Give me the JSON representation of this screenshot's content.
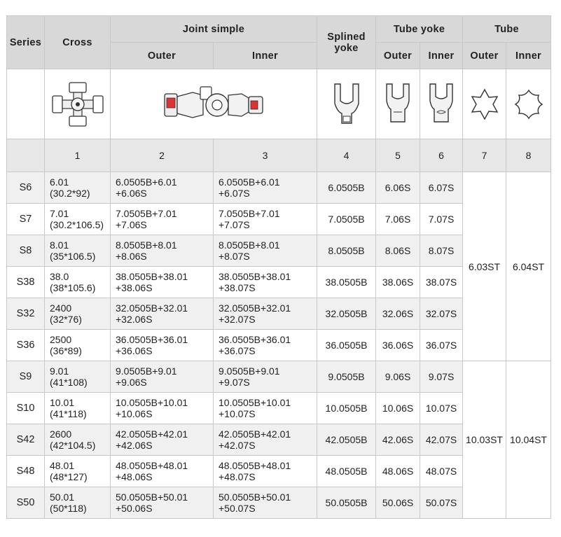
{
  "headers": {
    "series": "Series",
    "cross": "Cross",
    "joint_simple": "Joint simple",
    "outer": "Outer",
    "inner": "Inner",
    "splined_yoke": [
      "Splined",
      "yoke"
    ],
    "tube_yoke": "Tube yoke",
    "tube_yoke_outer": "Outer",
    "tube_yoke_inner": "Inner",
    "tube": "Tube",
    "tube_outer": "Outer",
    "tube_inner": "Inner"
  },
  "index_row": [
    "1",
    "2",
    "3",
    "4",
    "5",
    "6",
    "7",
    "8"
  ],
  "rows": [
    {
      "series": "S6",
      "cross": [
        "6.01",
        "(30.2*92)"
      ],
      "outer": [
        "6.0505B+6.01",
        "+6.06S"
      ],
      "inner": [
        "6.0505B+6.01",
        "+6.07S"
      ],
      "splined": "6.0505B",
      "ty_outer": "6.06S",
      "ty_inner": "6.07S"
    },
    {
      "series": "S7",
      "cross": [
        "7.01",
        "(30.2*106.5)"
      ],
      "outer": [
        "7.0505B+7.01",
        "+7.06S"
      ],
      "inner": [
        "7.0505B+7.01",
        "+7.07S"
      ],
      "splined": "7.0505B",
      "ty_outer": "7.06S",
      "ty_inner": "7.07S"
    },
    {
      "series": "S8",
      "cross": [
        "8.01",
        "(35*106.5)"
      ],
      "outer": [
        "8.0505B+8.01",
        "+8.06S"
      ],
      "inner": [
        "8.0505B+8.01",
        "+8.07S"
      ],
      "splined": "8.0505B",
      "ty_outer": "8.06S",
      "ty_inner": "8.07S"
    },
    {
      "series": "S38",
      "cross": [
        "38.0",
        "(38*105.6)"
      ],
      "outer": [
        "38.0505B+38.01",
        "+38.06S"
      ],
      "inner": [
        "38.0505B+38.01",
        "+38.07S"
      ],
      "splined": "38.0505B",
      "ty_outer": "38.06S",
      "ty_inner": "38.07S"
    },
    {
      "series": "S32",
      "cross": [
        "2400",
        "(32*76)"
      ],
      "outer": [
        "32.0505B+32.01",
        "+32.06S"
      ],
      "inner": [
        "32.0505B+32.01",
        "+32.07S"
      ],
      "splined": "32.0505B",
      "ty_outer": "32.06S",
      "ty_inner": "32.07S"
    },
    {
      "series": "S36",
      "cross": [
        "2500",
        "(36*89)"
      ],
      "outer": [
        "36.0505B+36.01",
        "+36.06S"
      ],
      "inner": [
        "36.0505B+36.01",
        "+36.07S"
      ],
      "splined": "36.0505B",
      "ty_outer": "36.06S",
      "ty_inner": "36.07S"
    },
    {
      "series": "S9",
      "cross": [
        "9.01",
        "(41*108)"
      ],
      "outer": [
        "9.0505B+9.01",
        "+9.06S"
      ],
      "inner": [
        "9.0505B+9.01",
        "+9.07S"
      ],
      "splined": "9.0505B",
      "ty_outer": "9.06S",
      "ty_inner": "9.07S"
    },
    {
      "series": "S10",
      "cross": [
        "10.01",
        "(41*118)"
      ],
      "outer": [
        "10.0505B+10.01",
        "+10.06S"
      ],
      "inner": [
        "10.0505B+10.01",
        "+10.07S"
      ],
      "splined": "10.0505B",
      "ty_outer": "10.06S",
      "ty_inner": "10.07S"
    },
    {
      "series": "S42",
      "cross": [
        "2600",
        "(42*104.5)"
      ],
      "outer": [
        "42.0505B+42.01",
        "+42.06S"
      ],
      "inner": [
        "42.0505B+42.01",
        "+42.07S"
      ],
      "splined": "42.0505B",
      "ty_outer": "42.06S",
      "ty_inner": "42.07S"
    },
    {
      "series": "S48",
      "cross": [
        "48.01",
        "(48*127)"
      ],
      "outer": [
        "48.0505B+48.01",
        "+48.06S"
      ],
      "inner": [
        "48.0505B+48.01",
        "+48.07S"
      ],
      "splined": "48.0505B",
      "ty_outer": "48.06S",
      "ty_inner": "48.07S"
    },
    {
      "series": "S50",
      "cross": [
        "50.01",
        "(50*118)"
      ],
      "outer": [
        "50.0505B+50.01",
        "+50.06S"
      ],
      "inner": [
        "50.0505B+50.01",
        "+50.07S"
      ],
      "splined": "50.0505B",
      "ty_outer": "50.06S",
      "ty_inner": "50.07S"
    }
  ],
  "tube_groups": [
    {
      "outer": "6.03ST",
      "inner": "6.04ST"
    },
    {
      "outer": "10.03ST",
      "inner": "10.04ST"
    }
  ],
  "icons": [
    "cross-icon",
    "joint-simple-icon",
    "splined-yoke-icon",
    "tube-yoke-outer-icon",
    "tube-yoke-inner-icon",
    "tube-outer-star-icon",
    "tube-inner-star-icon"
  ]
}
